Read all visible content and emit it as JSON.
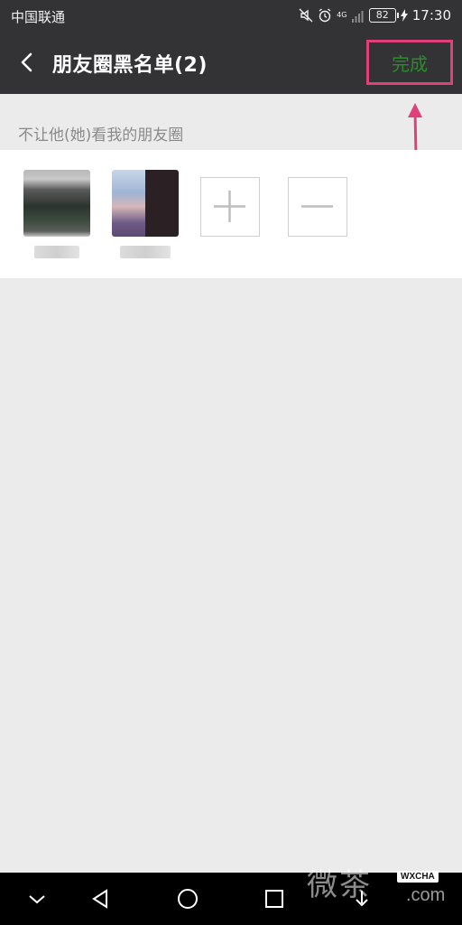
{
  "status_bar": {
    "carrier": "中国联通",
    "network_type": "4G",
    "battery": "82",
    "time": "17:30"
  },
  "nav": {
    "title": "朋友圈黑名单(2)",
    "done_label": "完成",
    "done_color": "#2f8a2f"
  },
  "section": {
    "label": "不让他(她)看我的朋友圈"
  },
  "members": [
    {
      "avatar": "avatar-1"
    },
    {
      "avatar": "avatar-2"
    }
  ],
  "actions": {
    "add_icon": "plus-icon",
    "remove_icon": "minus-icon"
  },
  "annotation": {
    "highlight_color": "#e0407a"
  },
  "watermark": {
    "text": "微茶",
    "badge": "WXCHA",
    "domain": ".com"
  }
}
